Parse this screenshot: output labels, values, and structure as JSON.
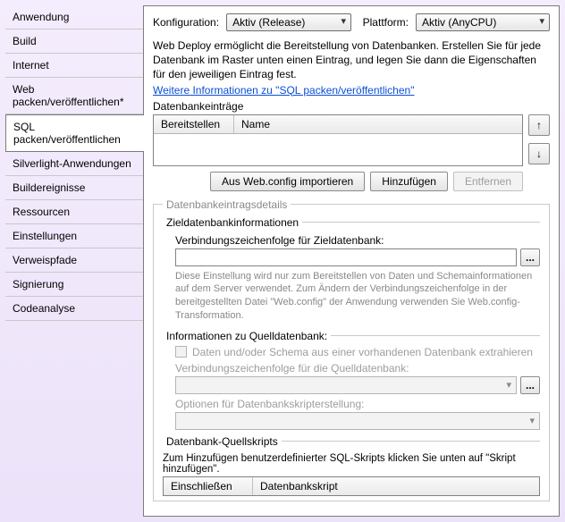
{
  "sidebar": {
    "items": [
      {
        "label": "Anwendung"
      },
      {
        "label": "Build"
      },
      {
        "label": "Internet"
      },
      {
        "label": "Web packen/veröffentlichen*"
      },
      {
        "label": "SQL packen/veröffentlichen"
      },
      {
        "label": "Silverlight-Anwendungen"
      },
      {
        "label": "Buildereignisse"
      },
      {
        "label": "Ressourcen"
      },
      {
        "label": "Einstellungen"
      },
      {
        "label": "Verweispfade"
      },
      {
        "label": "Signierung"
      },
      {
        "label": "Codeanalyse"
      }
    ],
    "selected_index": 4
  },
  "config": {
    "konfiguration_label": "Konfiguration:",
    "konfiguration_value": "Aktiv (Release)",
    "plattform_label": "Plattform:",
    "plattform_value": "Aktiv (AnyCPU)"
  },
  "intro": {
    "text": "Web Deploy ermöglicht die Bereitstellung von Datenbanken. Erstellen Sie für jede Datenbank im Raster unten einen Eintrag, und legen Sie dann die Eigenschaften für den jeweiligen Eintrag fest.",
    "link": "Weitere Informationen zu \"SQL packen/veröffentlichen\""
  },
  "entries": {
    "label": "Datenbankeinträge",
    "col_bereitstellen": "Bereitstellen",
    "col_name": "Name",
    "btn_import": "Aus Web.config importieren",
    "btn_add": "Hinzufügen",
    "btn_remove": "Entfernen",
    "arrow_up": "↑",
    "arrow_down": "↓"
  },
  "details": {
    "legend": "Datenbankeintragsdetails",
    "target": {
      "legend": "Zieldatenbankinformationen",
      "conn_label": "Verbindungszeichenfolge für Zieldatenbank:",
      "conn_value": "",
      "ellipsis": "...",
      "hint": "Diese Einstellung wird nur zum Bereitstellen von Daten und Schemainformationen auf dem Server verwendet. Zum Ändern der Verbindungszeichenfolge in der bereitgestellten Datei \"Web.config\" der Anwendung verwenden Sie Web.config-Transformation."
    },
    "source": {
      "legend": "Informationen zu Quelldatenbank:",
      "checkbox_label": "Daten und/oder Schema aus einer vorhandenen Datenbank extrahieren",
      "conn_label": "Verbindungszeichenfolge für die Quelldatenbank:",
      "ellipsis": "...",
      "options_label": "Optionen für Datenbankskripterstellung:"
    },
    "scripts": {
      "legend": "Datenbank-Quellskripts",
      "hint": "Zum Hinzufügen benutzerdefinierter SQL-Skripts klicken Sie unten auf \"Skript hinzufügen\".",
      "col_include": "Einschließen",
      "col_script": "Datenbankskript"
    }
  }
}
